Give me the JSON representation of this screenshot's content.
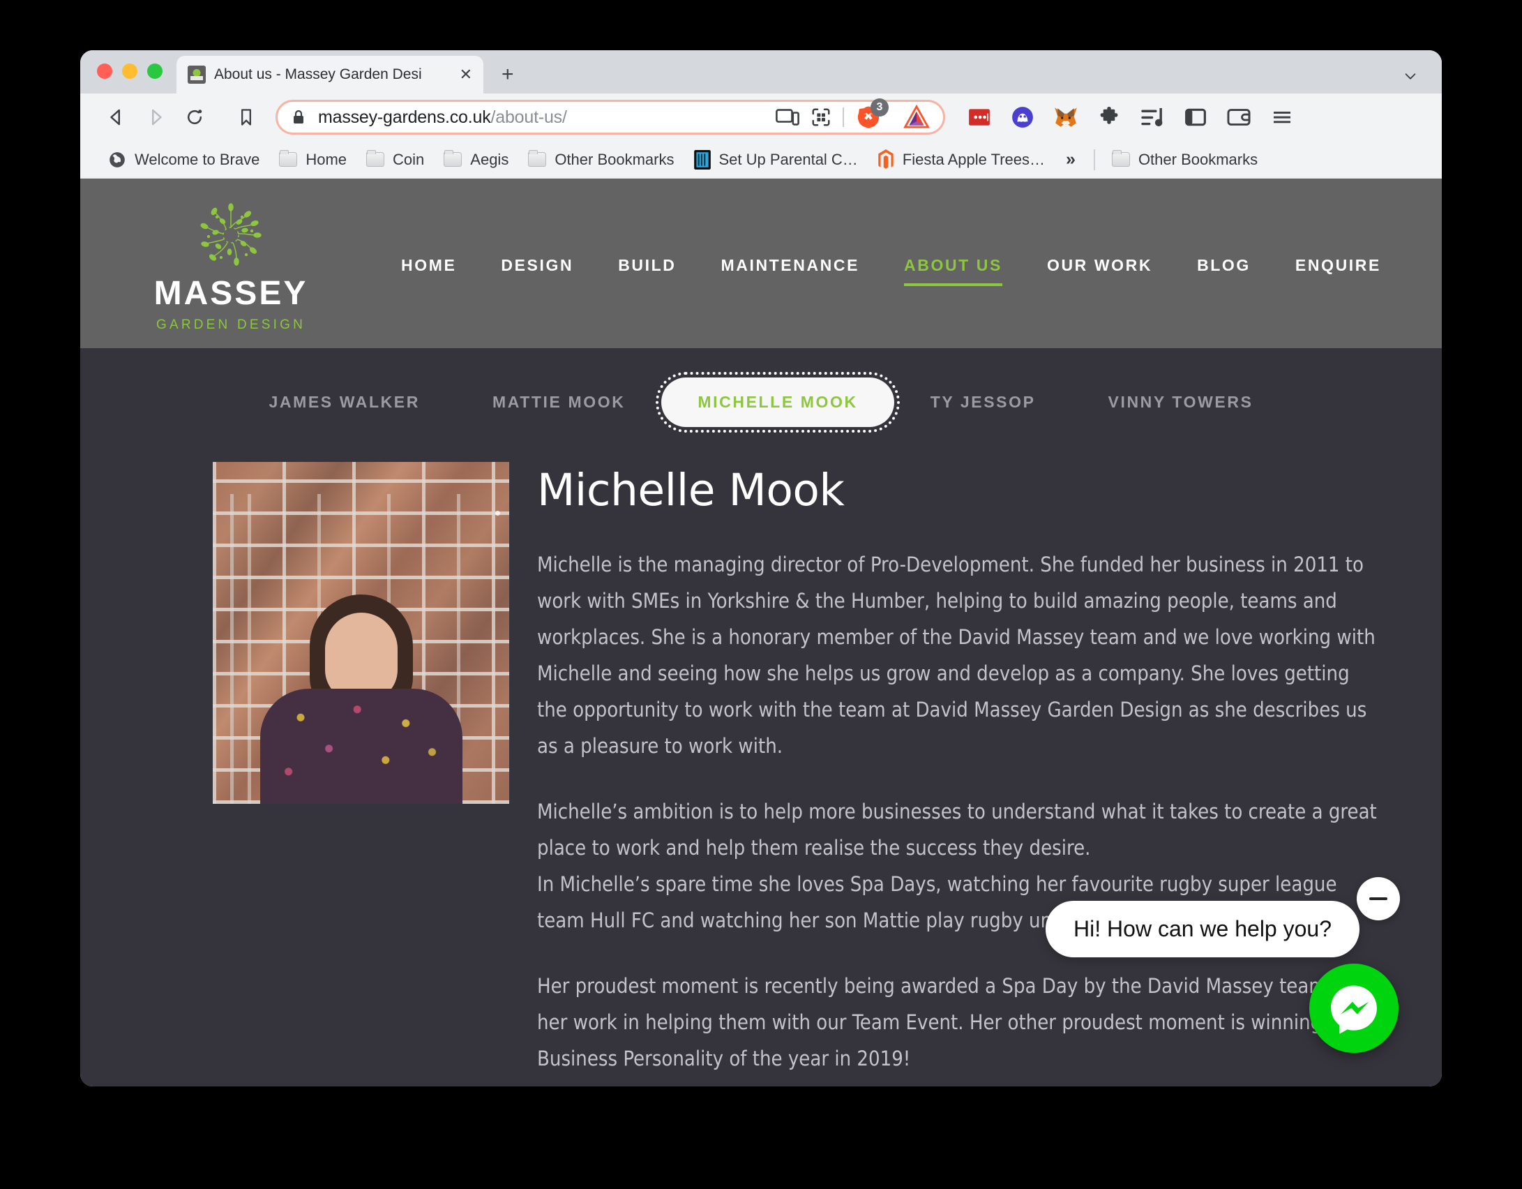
{
  "browser": {
    "tab": {
      "title": "About us - Massey Garden Desi",
      "favicon_name": "massey-favicon",
      "close_label": "✕"
    },
    "new_tab_label": "+",
    "nav": {
      "back_name": "back-button",
      "forward_name": "forward-button",
      "reload_name": "reload-button",
      "bookmark_name": "bookmark-star-button"
    },
    "omnibox": {
      "url_domain": "massey-gardens.co.uk",
      "url_path": "/about-us/",
      "lock_icon": "lock-icon",
      "cast_icon": "cast-icon",
      "qr_icon": "qr-code-icon",
      "shields_icon": "brave-shields-lion-icon",
      "shields_count": "3",
      "rewards_icon": "brave-rewards-triangle-icon"
    },
    "extensions": [
      {
        "name": "lastpass-extension-icon",
        "label": "LastPass"
      },
      {
        "name": "purple-ghost-extension-icon",
        "label": "Extension"
      },
      {
        "name": "metamask-extension-icon",
        "label": "MetaMask"
      },
      {
        "name": "puzzle-extensions-icon",
        "label": "Extensions"
      },
      {
        "name": "playlist-icon",
        "label": "Playlist"
      },
      {
        "name": "sidebar-icon",
        "label": "Sidebar"
      },
      {
        "name": "wallet-icon",
        "label": "Wallet"
      },
      {
        "name": "main-menu-icon",
        "label": "Menu"
      }
    ],
    "bookmarks": [
      {
        "label": "Welcome to Brave",
        "icon": "globe-icon"
      },
      {
        "label": "Home",
        "icon": "folder-icon"
      },
      {
        "label": "Coin",
        "icon": "folder-icon"
      },
      {
        "label": "Aegis",
        "icon": "folder-icon"
      },
      {
        "label": "Other Bookmarks",
        "icon": "folder-icon"
      },
      {
        "label": "Set Up Parental C…",
        "icon": "parental-controls-icon"
      },
      {
        "label": "Fiesta Apple Trees…",
        "icon": "magento-icon"
      }
    ],
    "bookmarks_overflow_label": "»",
    "bookmarks_far_right": {
      "label": "Other Bookmarks",
      "icon": "folder-icon"
    }
  },
  "site": {
    "logo": {
      "mark": "tree-logo-icon",
      "name": "MASSEY",
      "tagline": "GARDEN DESIGN"
    },
    "nav": [
      {
        "label": "HOME",
        "active": false
      },
      {
        "label": "DESIGN",
        "active": false
      },
      {
        "label": "BUILD",
        "active": false
      },
      {
        "label": "MAINTENANCE",
        "active": false
      },
      {
        "label": "ABOUT US",
        "active": true
      },
      {
        "label": "OUR WORK",
        "active": false
      },
      {
        "label": "BLOG",
        "active": false
      },
      {
        "label": "ENQUIRE",
        "active": false
      }
    ],
    "team_tabs": [
      {
        "label": "JAMES WALKER",
        "active": false
      },
      {
        "label": "MATTIE MOOK",
        "active": false
      },
      {
        "label": "MICHELLE MOOK",
        "active": true
      },
      {
        "label": "TY JESSOP",
        "active": false
      },
      {
        "label": "VINNY TOWERS",
        "active": false
      }
    ],
    "bio": {
      "photo_alt": "Michelle Mook portrait in front of a brick wall",
      "name": "Michelle Mook",
      "paragraphs": [
        "Michelle is the managing director of Pro-Development. She funded her business in 2011 to work with SMEs in Yorkshire & the Humber, helping to build amazing people, teams and workplaces. She is a honorary member of the David Massey team and we love working with Michelle and seeing how she helps us grow and develop as a company. She loves getting the opportunity to work with the team at David Massey Garden Design as she describes us as a pleasure to work with.",
        "Michelle’s ambition is to help more businesses to understand what it takes to create a great place to work and help them realise the success they desire.",
        "In Michelle’s spare time she loves Spa Days, watching her favourite rugby super league team Hull FC and watching her son Mattie play rugby union.",
        "Her proudest moment is recently being awarded a Spa Day by the David Massey team for her work in helping them with our Team Event. Her other proudest moment is winning Business Personality of the year in 2019!"
      ]
    },
    "messenger": {
      "greeting": "Hi! How can we help you?",
      "minimize_name": "minimize-chat-button",
      "button_name": "messenger-chat-button"
    },
    "colors": {
      "header_bg": "#636363",
      "page_bg": "#35343c",
      "accent_green": "#8dc63f",
      "messenger_green": "#00d40f",
      "body_text": "#c3c3c9"
    }
  }
}
